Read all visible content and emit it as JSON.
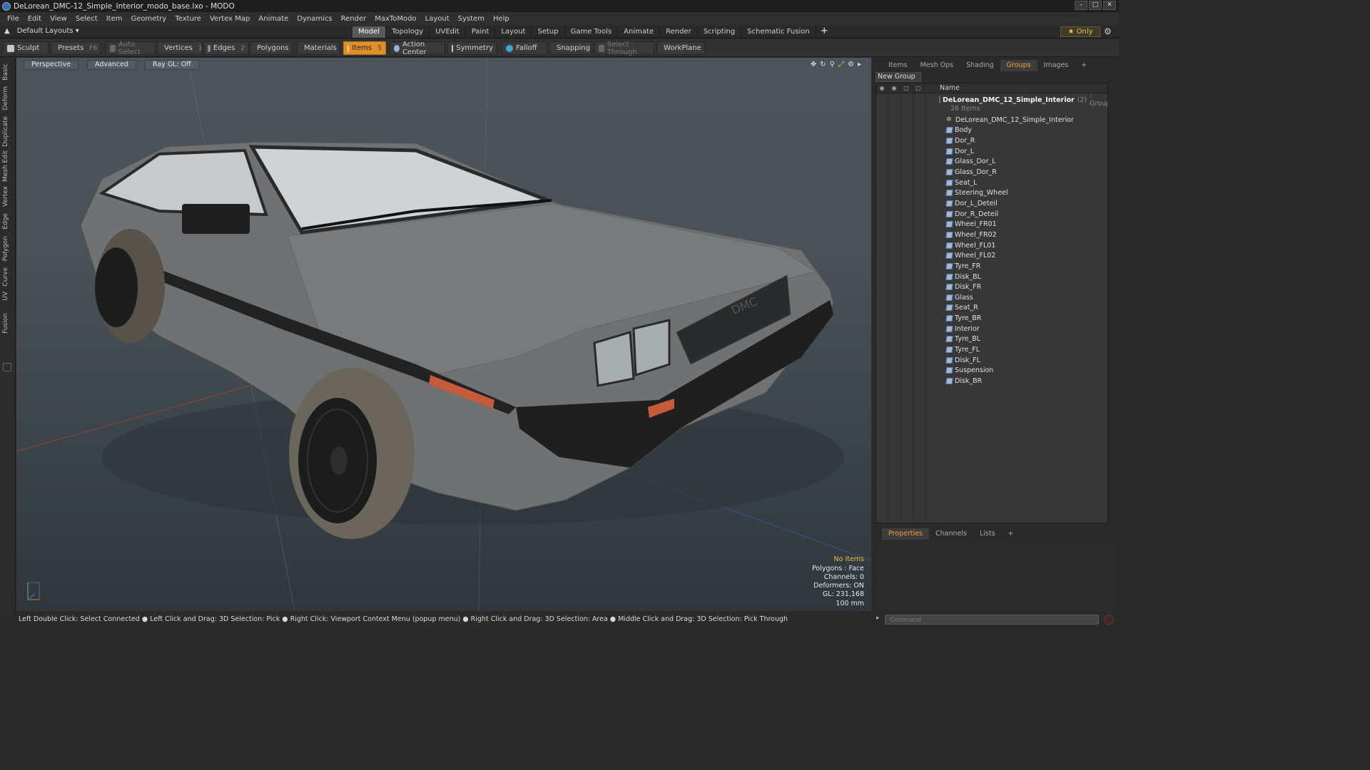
{
  "window": {
    "title": "DeLorean_DMC-12_Simple_Interior_modo_base.lxo - MODO",
    "controls": [
      "–",
      "□",
      "✕"
    ]
  },
  "menu": [
    "File",
    "Edit",
    "View",
    "Select",
    "Item",
    "Geometry",
    "Texture",
    "Vertex Map",
    "Animate",
    "Dynamics",
    "Render",
    "MaxToModo",
    "Layout",
    "System",
    "Help"
  ],
  "layout_bar": {
    "layouts_label": "Default Layouts ▾",
    "tabs": [
      "Model",
      "Topology",
      "UVEdit",
      "Paint",
      "Layout",
      "Setup",
      "Game Tools",
      "Animate",
      "Render",
      "Scripting",
      "Schematic Fusion"
    ],
    "active_tab": "Model",
    "plus": "+",
    "only_label": "★ Only"
  },
  "toolbar": {
    "sculpt": "Sculpt",
    "presets": "Presets",
    "presets_key": "F6",
    "auto_select": "Auto Select",
    "vertices": "Vertices",
    "vertices_key": "1",
    "edges": "Edges",
    "edges_key": "2",
    "polygons": "Polygons",
    "materials": "Materials",
    "items": "Items",
    "items_key": "5",
    "action_center": "Action Center",
    "symmetry": "Symmetry",
    "falloff": "Falloff",
    "snapping": "Snapping",
    "select_through": "Select Through",
    "workplane": "WorkPlane"
  },
  "left_tabs": [
    "Basic",
    "Deform",
    "Duplicate",
    "Mesh Edit",
    "Vertex",
    "Edge",
    "Polygon",
    "Curve",
    "UV",
    "Fusion"
  ],
  "viewport": {
    "view_mode": "Perspective",
    "shading": "Advanced",
    "raygl": "Ray GL: Off",
    "info": {
      "selection": "No Items",
      "polygons": "Polygons : Face",
      "channels": "Channels: 0",
      "deformers": "Deformers: ON",
      "gl": "GL: 231,168",
      "scale": "100 mm"
    }
  },
  "status_bar": "Left Double Click: Select Connected ● Left Click and Drag: 3D Selection: Pick ● Right Click: Viewport Context Menu (popup menu) ● Right Click and Drag: 3D Selection: Area ● Middle Click and Drag: 3D Selection: Pick Through",
  "right_panel": {
    "tabs": [
      "Items",
      "Mesh Ops",
      "Shading",
      "Groups",
      "Images",
      "+"
    ],
    "active_tab": "Groups",
    "new_group": "New Group",
    "name_header": "Name",
    "group": {
      "name": "DeLorean_DMC_12_Simple_Interior",
      "count": "(2)",
      "type": ": Group",
      "items_count": "26 Items"
    },
    "items": [
      {
        "name": "DeLorean_DMC_12_Simple_Interior",
        "kind": "locator"
      },
      {
        "name": "Body",
        "kind": "mesh"
      },
      {
        "name": "Dor_R",
        "kind": "mesh"
      },
      {
        "name": "Dor_L",
        "kind": "mesh"
      },
      {
        "name": "Glass_Dor_L",
        "kind": "mesh"
      },
      {
        "name": "Glass_Dor_R",
        "kind": "mesh"
      },
      {
        "name": "Seat_L",
        "kind": "mesh"
      },
      {
        "name": "Steering_Wheel",
        "kind": "mesh"
      },
      {
        "name": "Dor_L_Deteil",
        "kind": "mesh"
      },
      {
        "name": "Dor_R_Deteil",
        "kind": "mesh"
      },
      {
        "name": "Wheel_FR01",
        "kind": "mesh"
      },
      {
        "name": "Wheel_FR02",
        "kind": "mesh"
      },
      {
        "name": "Wheel_FL01",
        "kind": "mesh"
      },
      {
        "name": "Wheel_FL02",
        "kind": "mesh"
      },
      {
        "name": "Tyre_FR",
        "kind": "mesh"
      },
      {
        "name": "Disk_BL",
        "kind": "mesh"
      },
      {
        "name": "Disk_FR",
        "kind": "mesh"
      },
      {
        "name": "Glass",
        "kind": "mesh"
      },
      {
        "name": "Seat_R",
        "kind": "mesh"
      },
      {
        "name": "Tyre_BR",
        "kind": "mesh"
      },
      {
        "name": "Interior",
        "kind": "mesh"
      },
      {
        "name": "Tyre_BL",
        "kind": "mesh"
      },
      {
        "name": "Tyre_FL",
        "kind": "mesh"
      },
      {
        "name": "Disk_FL",
        "kind": "mesh"
      },
      {
        "name": "Suspension",
        "kind": "mesh"
      },
      {
        "name": "Disk_BR",
        "kind": "mesh"
      }
    ],
    "bottom_tabs": [
      "Properties",
      "Channels",
      "Lists",
      "+"
    ],
    "bottom_active": "Properties",
    "command_placeholder": "Command"
  },
  "colors": {
    "accent": "#e0902b",
    "active_tab_text": "#f0a030",
    "warning_text": "#f0c040"
  }
}
